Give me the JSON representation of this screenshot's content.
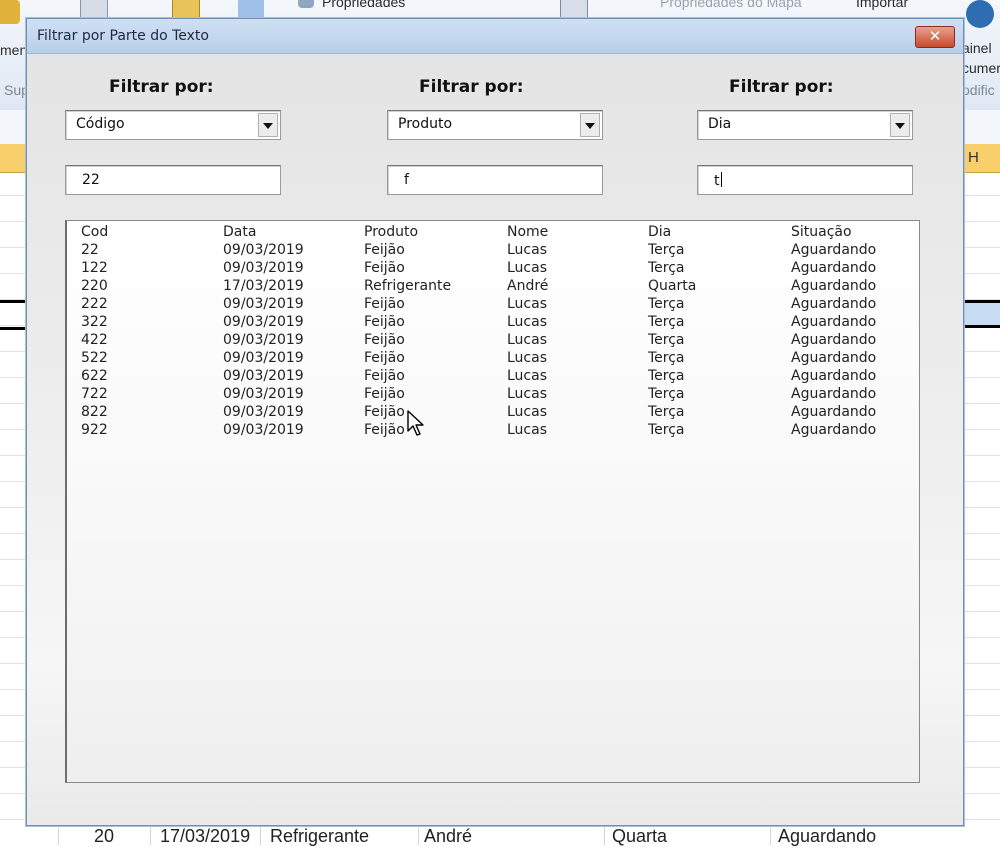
{
  "background": {
    "ribbon": {
      "properties_label": "Propriedades",
      "map_properties_label": "Propriedades do Mapa",
      "import_label": "Importar",
      "left_fragments": [
        "ment",
        "Sup"
      ],
      "right_fragments": [
        "ainel",
        "cumer",
        "odific"
      ]
    },
    "column_h_label": "H",
    "bottom_row": [
      "20",
      "17/03/2019",
      "Refrigerante",
      "André",
      "Quarta",
      "Aguardando"
    ]
  },
  "dialog": {
    "title": "Filtrar por Parte do Texto",
    "close_symbol": "✕",
    "filters": [
      {
        "label": "Filtrar por:",
        "selected": "Código",
        "text": "22"
      },
      {
        "label": "Filtrar por:",
        "selected": "Produto",
        "text": "f"
      },
      {
        "label": "Filtrar por:",
        "selected": "Dia",
        "text": "t"
      }
    ],
    "list": {
      "headers": [
        "Cod",
        "Data",
        "Produto",
        "Nome",
        "Dia",
        "Situação"
      ],
      "rows": [
        [
          "22",
          "09/03/2019",
          "Feijão",
          "Lucas",
          "Terça",
          "Aguardando"
        ],
        [
          "122",
          "09/03/2019",
          "Feijão",
          "Lucas",
          "Terça",
          "Aguardando"
        ],
        [
          "220",
          "17/03/2019",
          "Refrigerante",
          "André",
          "Quarta",
          "Aguardando"
        ],
        [
          "222",
          "09/03/2019",
          "Feijão",
          "Lucas",
          "Terça",
          "Aguardando"
        ],
        [
          "322",
          "09/03/2019",
          "Feijão",
          "Lucas",
          "Terça",
          "Aguardando"
        ],
        [
          "422",
          "09/03/2019",
          "Feijão",
          "Lucas",
          "Terça",
          "Aguardando"
        ],
        [
          "522",
          "09/03/2019",
          "Feijão",
          "Lucas",
          "Terça",
          "Aguardando"
        ],
        [
          "622",
          "09/03/2019",
          "Feijão",
          "Lucas",
          "Terça",
          "Aguardando"
        ],
        [
          "722",
          "09/03/2019",
          "Feijão",
          "Lucas",
          "Terça",
          "Aguardando"
        ],
        [
          "822",
          "09/03/2019",
          "Feijão",
          "Lucas",
          "Terça",
          "Aguardando"
        ],
        [
          "922",
          "09/03/2019",
          "Feijão",
          "Lucas",
          "Terça",
          "Aguardando"
        ]
      ]
    }
  },
  "colors": {
    "column_header": "#f8cf6a",
    "title_bar": "#c4d8ee",
    "close_button": "#c84a2d"
  }
}
